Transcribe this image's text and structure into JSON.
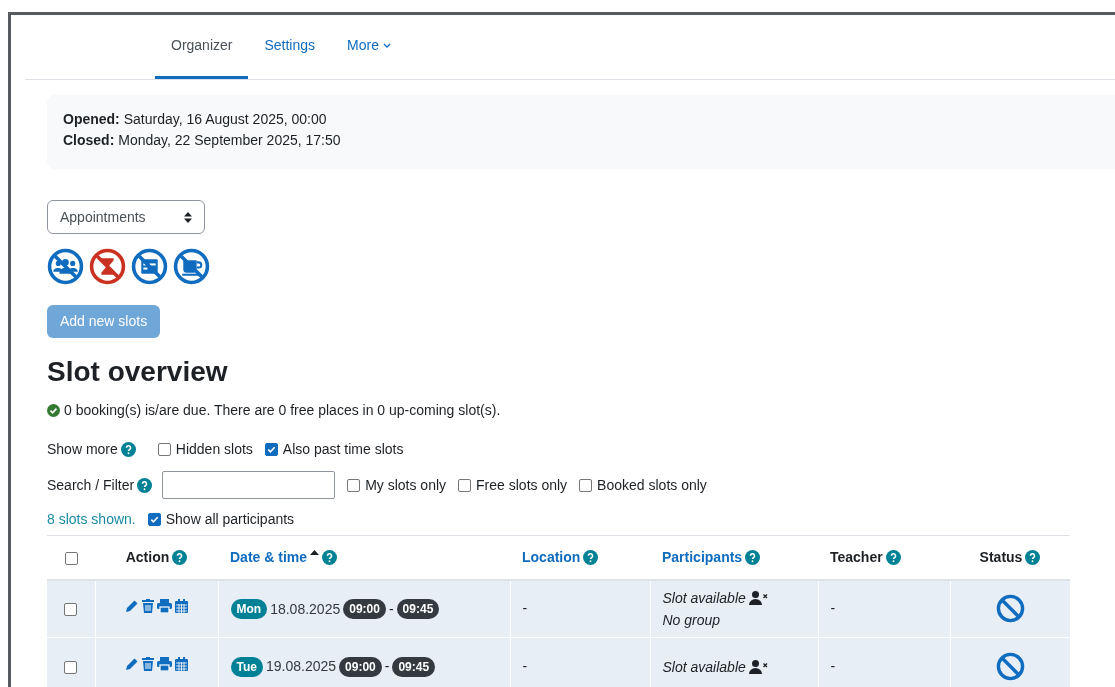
{
  "tabs": [
    {
      "label": "Organizer",
      "selected": true,
      "dropdown": false
    },
    {
      "label": "Settings",
      "selected": false,
      "dropdown": false
    },
    {
      "label": "More",
      "selected": false,
      "dropdown": true
    }
  ],
  "info": [
    {
      "label": "Opened:",
      "value": "Saturday, 16 August 2025, 00:00"
    },
    {
      "label": "Closed:",
      "value": "Monday, 22 September 2025, 17:50"
    }
  ],
  "view_select": {
    "value": "Appointments"
  },
  "mode_icons": [
    {
      "kind": "group",
      "color": "#0f6cbf"
    },
    {
      "kind": "hourglass",
      "color": "#ca3120"
    },
    {
      "kind": "form",
      "color": "#0f6cbf"
    },
    {
      "kind": "cup",
      "color": "#0f6cbf"
    }
  ],
  "add_button": {
    "label": "Add new slots",
    "disabled": true
  },
  "heading": "Slot overview",
  "summary": "0 booking(s) is/are due. There are 0 free places in 0 up-coming slot(s).",
  "show_more": {
    "label": "Show more",
    "options": [
      {
        "label": "Hidden slots",
        "checked": false
      },
      {
        "label": "Also past time slots",
        "checked": true
      }
    ]
  },
  "filter": {
    "label": "Search / Filter",
    "options": [
      {
        "label": "My slots only",
        "checked": false
      },
      {
        "label": "Free slots only",
        "checked": false
      },
      {
        "label": "Booked slots only",
        "checked": false
      }
    ]
  },
  "shown": {
    "text": "8 slots shown.",
    "option": {
      "label": "Show all participants",
      "checked": true
    }
  },
  "table": {
    "select_all": {
      "checked": false
    },
    "columns": [
      {
        "label": "Action",
        "link": false,
        "sorted": false
      },
      {
        "label": "Date & time",
        "link": true,
        "sorted": true
      },
      {
        "label": "Location",
        "link": true,
        "sorted": false
      },
      {
        "label": "Participants",
        "link": true,
        "sorted": false
      },
      {
        "label": "Teacher",
        "link": false,
        "sorted": false
      },
      {
        "label": "Status",
        "link": false,
        "sorted": false
      }
    ],
    "rows": [
      {
        "checked": false,
        "day": "Mon",
        "date": "18.08.2025",
        "start": "09:00",
        "separator": "-",
        "end": "09:45",
        "location": "-",
        "participants": [
          "Slot available",
          "No group"
        ],
        "teacher": "-"
      },
      {
        "checked": false,
        "day": "Tue",
        "date": "19.08.2025",
        "start": "09:00",
        "separator": "-",
        "end": "09:45",
        "location": "-",
        "participants": [
          "Slot available"
        ],
        "teacher": "-"
      }
    ]
  }
}
